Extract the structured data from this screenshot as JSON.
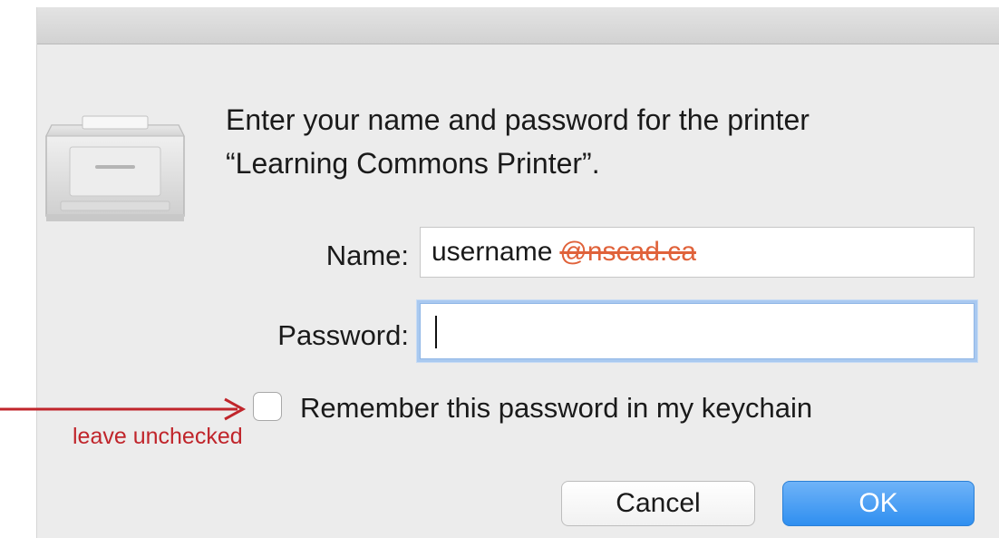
{
  "dialog": {
    "message_line1": "Enter your name and password for the printer",
    "message_line2": "“Learning Commons Printer”."
  },
  "form": {
    "name_label": "Name:",
    "name_value": "username",
    "name_domain_struck": "@nscad.ca",
    "password_label": "Password:",
    "password_value": "",
    "remember_label": "Remember this password in my keychain",
    "remember_checked": false
  },
  "buttons": {
    "cancel_label": "Cancel",
    "ok_label": "OK"
  },
  "annotation": {
    "text": "leave unchecked",
    "color": "#c0252b"
  },
  "icons": {
    "printer": "printer-icon",
    "arrow": "arrow-right-icon"
  },
  "colors": {
    "accent": "#2f8ff0",
    "struck_text": "#e0623a",
    "focus_ring": "#a9c9f0"
  }
}
